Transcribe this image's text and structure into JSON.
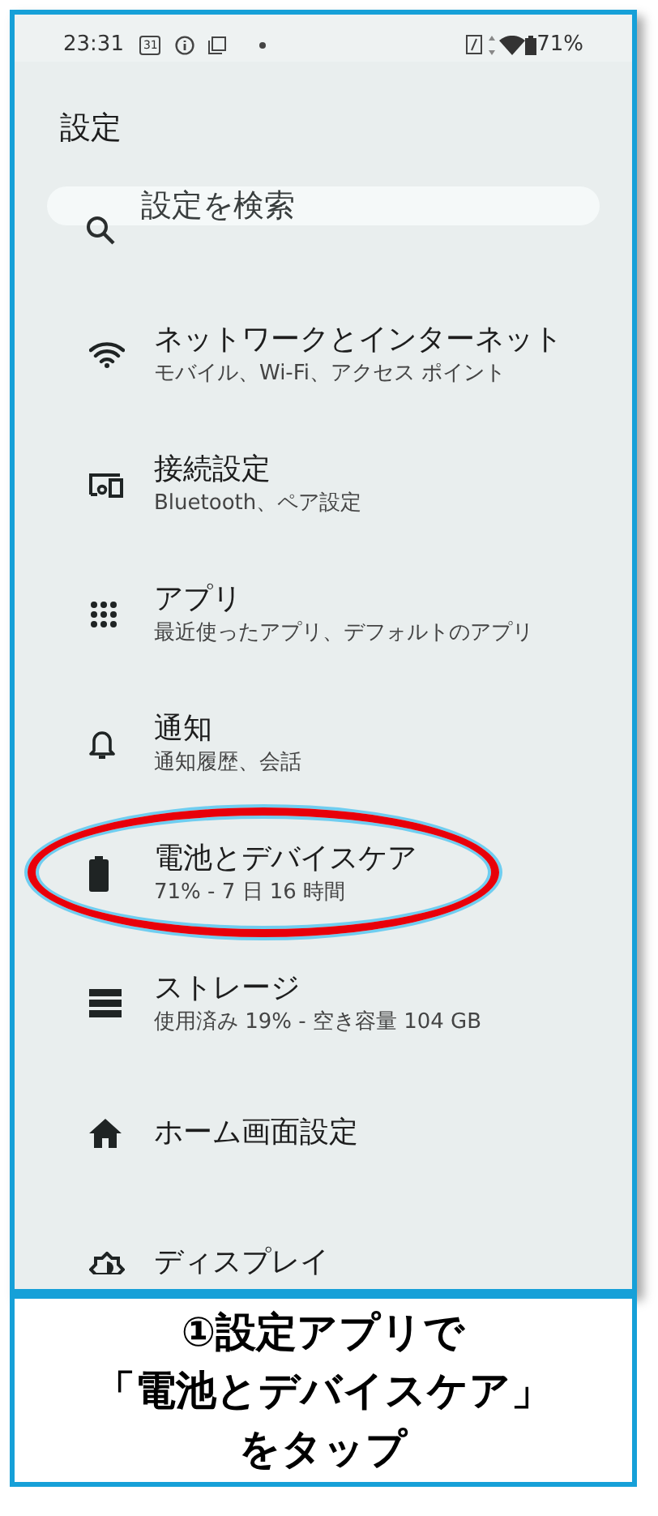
{
  "status_bar": {
    "time": "23:31",
    "calendar_day": "31",
    "battery": "71%"
  },
  "title": "設定",
  "search": {
    "placeholder": "設定を検索"
  },
  "items": [
    {
      "kind": "wifi",
      "title": "ネットワークとインターネット",
      "subtitle": "モバイル、Wi-Fi、アクセス ポイント",
      "highlighted": false
    },
    {
      "kind": "devices",
      "title": "接続設定",
      "subtitle": "Bluetooth、ペア設定",
      "highlighted": false
    },
    {
      "kind": "apps",
      "title": "アプリ",
      "subtitle": "最近使ったアプリ、デフォルトのアプリ",
      "highlighted": false
    },
    {
      "kind": "bell",
      "title": "通知",
      "subtitle": "通知履歴、会話",
      "highlighted": false
    },
    {
      "kind": "battery",
      "title": "電池とデバイスケア",
      "subtitle": "71% - 7 日 16 時間",
      "highlighted": true
    },
    {
      "kind": "storage",
      "title": "ストレージ",
      "subtitle": "使用済み 19% - 空き容量 104 GB",
      "highlighted": false
    },
    {
      "kind": "home",
      "title": "ホーム画面設定",
      "highlighted": false
    },
    {
      "kind": "display",
      "title": "ディスプレイ",
      "highlighted": false
    }
  ],
  "caption": [
    "①設定アプリで",
    "「電池とデバイスケア」",
    "をタップ"
  ]
}
